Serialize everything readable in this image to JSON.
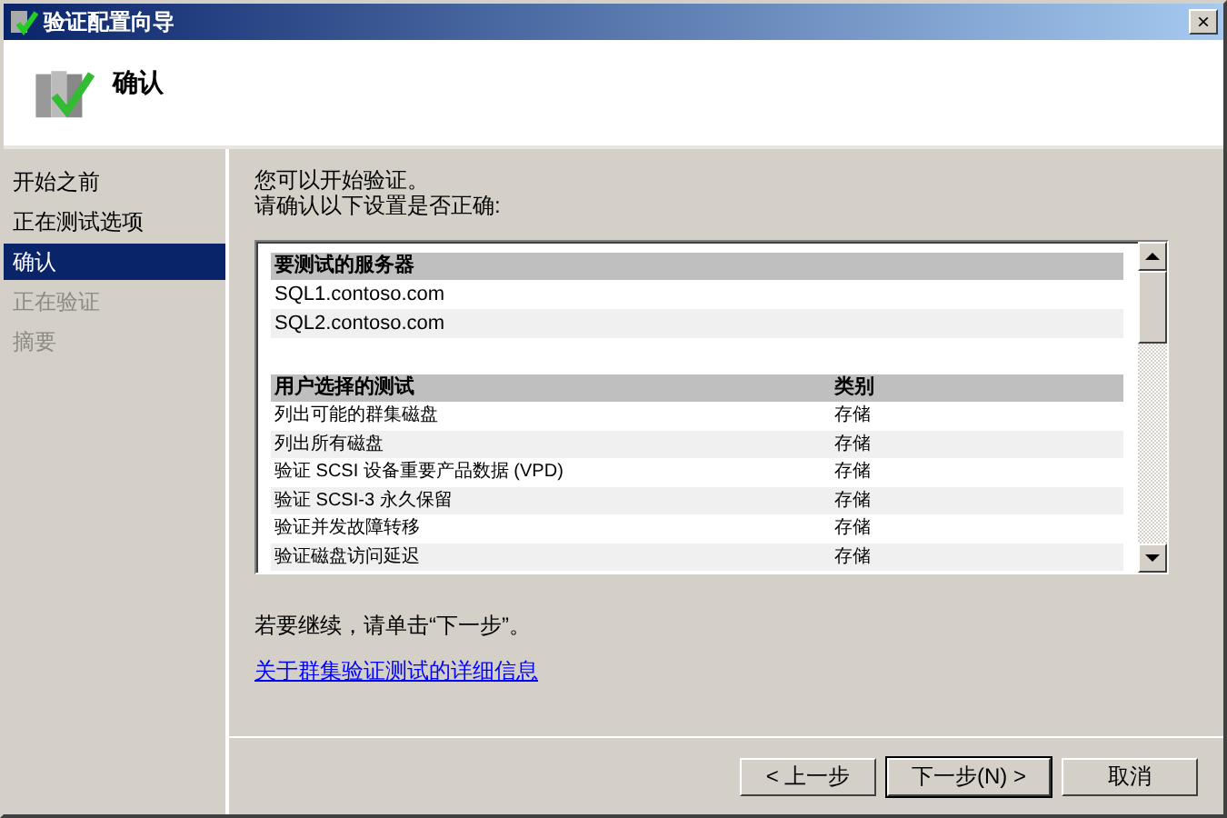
{
  "window": {
    "title": "验证配置向导",
    "close": "×"
  },
  "header": {
    "title": "确认"
  },
  "sidebar": {
    "items": [
      {
        "label": "开始之前",
        "selected": false,
        "disabled": false
      },
      {
        "label": "正在测试选项",
        "selected": false,
        "disabled": false
      },
      {
        "label": "确认",
        "selected": true,
        "disabled": false
      },
      {
        "label": "正在验证",
        "selected": false,
        "disabled": true
      },
      {
        "label": "摘要",
        "selected": false,
        "disabled": true
      }
    ]
  },
  "intro": [
    "您可以开始验证。",
    "请确认以下设置是否正确:"
  ],
  "servers": {
    "heading": "要测试的服务器",
    "rows": [
      "SQL1.contoso.com",
      "SQL2.contoso.com"
    ]
  },
  "tests": {
    "columns": [
      "用户选择的测试",
      "类别"
    ],
    "rows": [
      [
        "列出可能的群集磁盘",
        "存储"
      ],
      [
        "列出所有磁盘",
        "存储"
      ],
      [
        "验证 SCSI 设备重要产品数据 (VPD)",
        "存储"
      ],
      [
        "验证 SCSI-3 永久保留",
        "存储"
      ],
      [
        "验证并发故障转移",
        "存储"
      ],
      [
        "验证磁盘访问延迟",
        "存储"
      ]
    ]
  },
  "continue_text": "若要继续，请单击“下一步”。",
  "link": "关于群集验证测试的详细信息",
  "buttons": [
    {
      "label": "< 上一步",
      "default": false
    },
    {
      "label": "下一步(N) >",
      "default": true
    },
    {
      "label": "取消",
      "default": false
    }
  ]
}
